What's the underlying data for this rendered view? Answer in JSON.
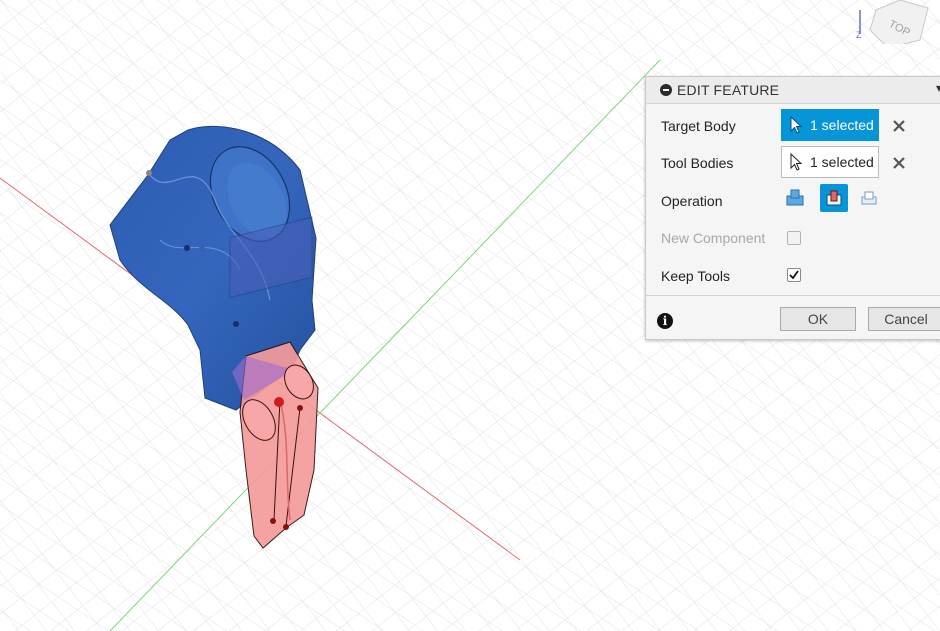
{
  "viewcube": {
    "face_label": "TOP",
    "axis_label": "Z"
  },
  "panel": {
    "title": "EDIT FEATURE",
    "target_body": {
      "label": "Target Body",
      "value": "1 selected"
    },
    "tool_bodies": {
      "label": "Tool Bodies",
      "value": "1 selected"
    },
    "operation": {
      "label": "Operation",
      "options": [
        "join-icon",
        "cut-icon",
        "intersect-icon"
      ],
      "selected": "cut-icon"
    },
    "new_component": {
      "label": "New Component",
      "checked": false,
      "enabled": false
    },
    "keep_tools": {
      "label": "Keep Tools",
      "checked": true
    },
    "ok_label": "OK",
    "cancel_label": "Cancel"
  },
  "colors": {
    "accent": "#0696d7",
    "target_body": "#2f5fb3",
    "tool_body": "#f28080",
    "annotation": "#e0111b"
  }
}
